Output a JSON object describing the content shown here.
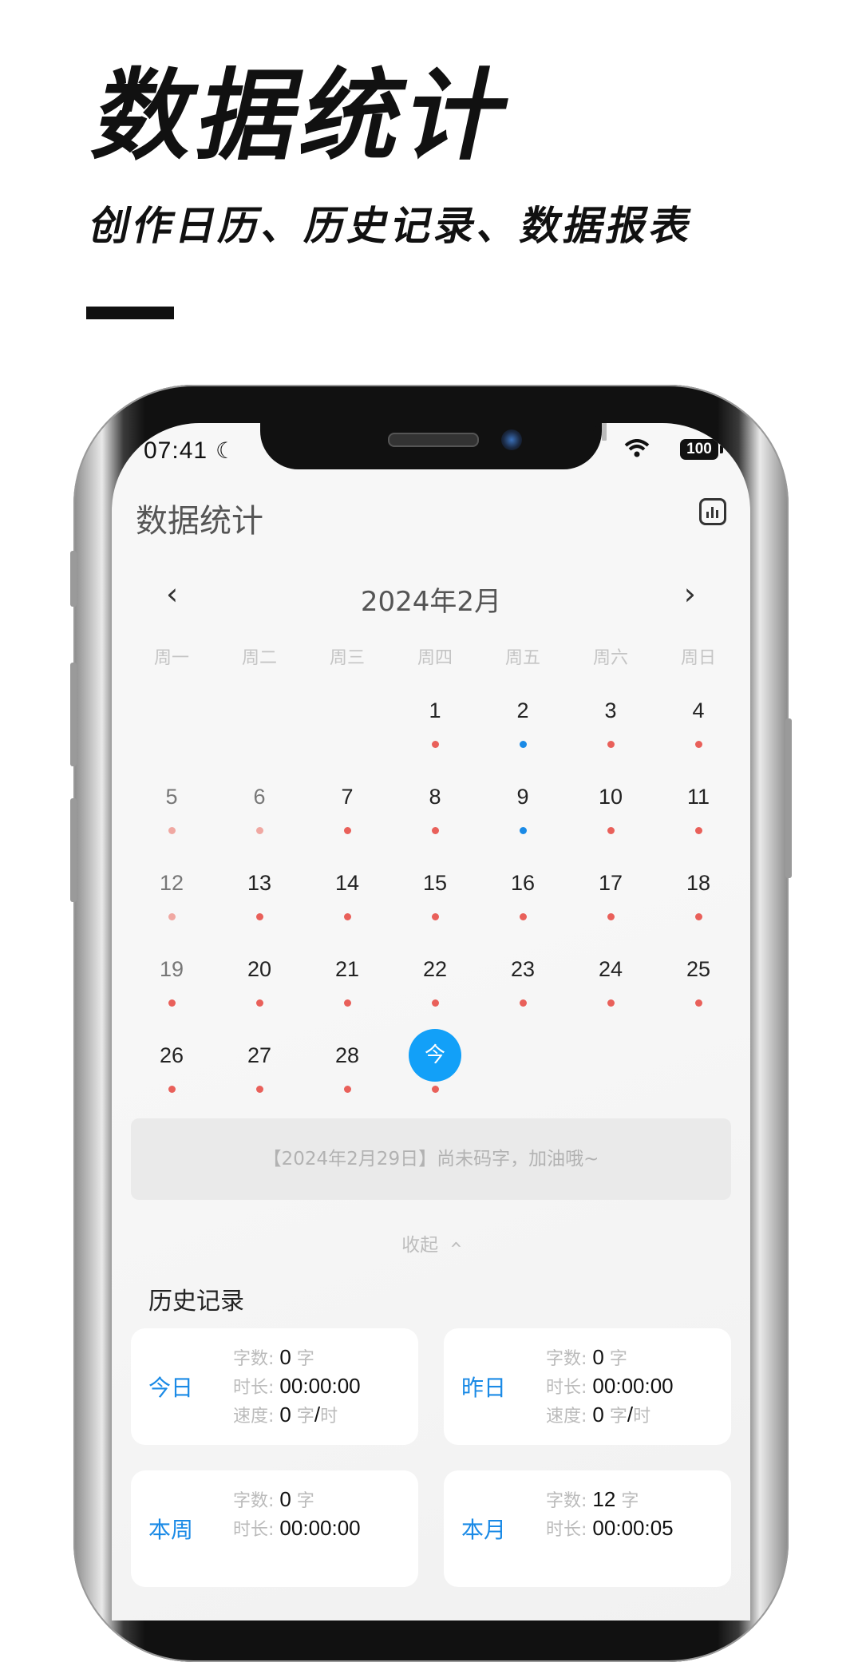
{
  "promo": {
    "title": "数据统计",
    "subtitle": "创作日历、历史记录、数据报表"
  },
  "status_bar": {
    "time": "07:41",
    "battery": "100"
  },
  "app": {
    "title": "数据统计",
    "stats_icon": "bar-chart-icon"
  },
  "calendar": {
    "month_label": "2024年2月",
    "prev_icon": "chevron-left-icon",
    "next_icon": "chevron-right-icon",
    "weekdays": [
      "周一",
      "周二",
      "周三",
      "周四",
      "周五",
      "周六",
      "周日"
    ],
    "days": [
      {
        "label": "1",
        "dot": "red"
      },
      {
        "label": "2",
        "dot": "blue"
      },
      {
        "label": "3",
        "dot": "red"
      },
      {
        "label": "4",
        "dot": "red"
      },
      {
        "label": "5",
        "dot": "light"
      },
      {
        "label": "6",
        "dot": "light"
      },
      {
        "label": "7",
        "dot": "red"
      },
      {
        "label": "8",
        "dot": "red"
      },
      {
        "label": "9",
        "dot": "blue"
      },
      {
        "label": "10",
        "dot": "red"
      },
      {
        "label": "11",
        "dot": "red"
      },
      {
        "label": "12",
        "dot": "light"
      },
      {
        "label": "13",
        "dot": "red"
      },
      {
        "label": "14",
        "dot": "red"
      },
      {
        "label": "15",
        "dot": "red"
      },
      {
        "label": "16",
        "dot": "red"
      },
      {
        "label": "17",
        "dot": "red"
      },
      {
        "label": "18",
        "dot": "red"
      },
      {
        "label": "19",
        "dot": "red"
      },
      {
        "label": "20",
        "dot": "red"
      },
      {
        "label": "21",
        "dot": "red"
      },
      {
        "label": "22",
        "dot": "red"
      },
      {
        "label": "23",
        "dot": "red"
      },
      {
        "label": "24",
        "dot": "red"
      },
      {
        "label": "25",
        "dot": "red"
      },
      {
        "label": "26",
        "dot": "red"
      },
      {
        "label": "27",
        "dot": "red"
      },
      {
        "label": "28",
        "dot": "red"
      },
      {
        "label": "今",
        "dot": "red",
        "today": true
      }
    ],
    "notice": "【2024年2月29日】尚未码字，加油哦~",
    "collapse_label": "收起"
  },
  "history": {
    "title": "历史记录",
    "labels": {
      "words": "字数:",
      "duration": "时长:",
      "speed": "速度:",
      "word_unit": "字",
      "per": "/",
      "hour_unit": "时"
    },
    "cards": [
      {
        "period": "今日",
        "words": "0",
        "duration": "00:00:00",
        "speed": "0"
      },
      {
        "period": "昨日",
        "words": "0",
        "duration": "00:00:00",
        "speed": "0"
      },
      {
        "period": "本周",
        "words": "0",
        "duration": "00:00:00",
        "speed": ""
      },
      {
        "period": "本月",
        "words": "12",
        "duration": "00:00:05",
        "speed": ""
      }
    ]
  },
  "colors": {
    "accent": "#12a0f8",
    "dot_red": "#e9605a",
    "dot_blue": "#1a8ae6"
  }
}
